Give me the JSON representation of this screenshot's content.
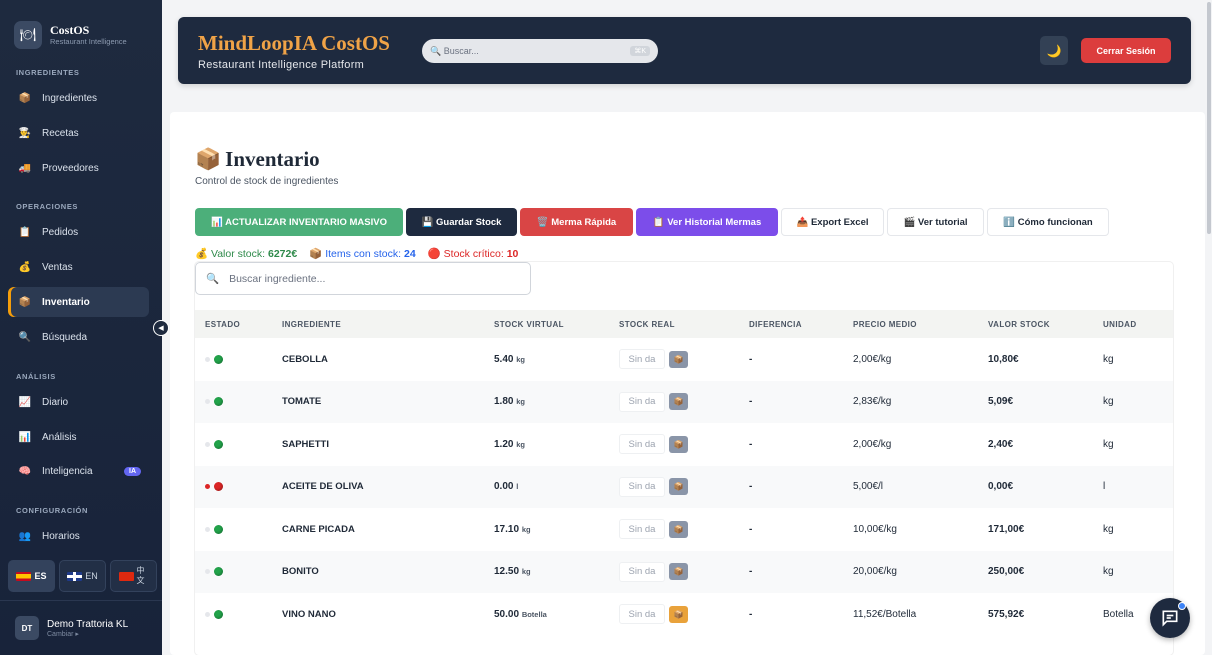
{
  "sidebar": {
    "brand_name": "CostOS",
    "brand_sub": "Restaurant Intelligence",
    "sections": {
      "ingredientes": "INGREDIENTES",
      "operaciones": "OPERACIONES",
      "analisis": "ANÁLISIS",
      "configuracion": "CONFIGURACIÓN"
    },
    "items": {
      "ingredientes": "Ingredientes",
      "recetas": "Recetas",
      "proveedores": "Proveedores",
      "pedidos": "Pedidos",
      "ventas": "Ventas",
      "inventario": "Inventario",
      "busqueda": "Búsqueda",
      "diario": "Diario",
      "analisis": "Análisis",
      "inteligencia": "Inteligencia",
      "horarios": "Horarios"
    },
    "ia_badge": "IA",
    "languages": {
      "es": "ES",
      "en": "EN",
      "zh": "中文"
    },
    "user": {
      "initials": "DT",
      "name": "Demo Trattoria KL",
      "sub": "Cambiar ▸"
    }
  },
  "header": {
    "title": "MindLoopIA CostOS",
    "subtitle": "Restaurant Intelligence Platform",
    "search_placeholder": "🔍 Buscar...",
    "search_kbd": "⌘K",
    "theme_icon": "🌙",
    "logout": "Cerrar Sesión"
  },
  "page": {
    "title_icon": "📦",
    "title": "Inventario",
    "subtitle": "Control de stock de ingredientes"
  },
  "toolbar": {
    "massive": "📊 ACTUALIZAR INVENTARIO MASIVO",
    "save": "💾 Guardar Stock",
    "merma": "🗑️ Merma Rápida",
    "historial": "📋 Ver Historial Mermas",
    "export": "📤 Export Excel",
    "tutorial": "🎬 Ver tutorial",
    "howto": "ℹ️ Cómo funcionan"
  },
  "stats": {
    "value_label": "💰 Valor stock:",
    "value": "6272€",
    "items_label": "📦 Items con stock:",
    "items": "24",
    "critical_label": "🔴 Stock crítico:",
    "critical": "10"
  },
  "table": {
    "search_placeholder": "Buscar ingrediente...",
    "columns": [
      "ESTADO",
      "INGREDIENTE",
      "STOCK VIRTUAL",
      "STOCK REAL",
      "DIFERENCIA",
      "PRECIO MEDIO",
      "VALOR STOCK",
      "UNIDAD"
    ],
    "input_placeholder": "Sin da",
    "rows": [
      {
        "status": "ok",
        "name": "CEBOLLA",
        "virtual": "5.40",
        "virtual_unit": "kg",
        "diff": "-",
        "price": "2,00€/kg",
        "value": "10,80€",
        "unit": "kg",
        "btn": "gray"
      },
      {
        "status": "ok",
        "name": "TOMATE",
        "virtual": "1.80",
        "virtual_unit": "kg",
        "diff": "-",
        "price": "2,83€/kg",
        "value": "5,09€",
        "unit": "kg",
        "btn": "gray"
      },
      {
        "status": "ok",
        "name": "SAPHETTI",
        "virtual": "1.20",
        "virtual_unit": "kg",
        "diff": "-",
        "price": "2,00€/kg",
        "value": "2,40€",
        "unit": "kg",
        "btn": "gray"
      },
      {
        "status": "critical",
        "name": "ACEITE DE OLIVA",
        "virtual": "0.00",
        "virtual_unit": "l",
        "diff": "-",
        "price": "5,00€/l",
        "value": "0,00€",
        "unit": "l",
        "btn": "gray"
      },
      {
        "status": "ok",
        "name": "CARNE PICADA",
        "virtual": "17.10",
        "virtual_unit": "kg",
        "diff": "-",
        "price": "10,00€/kg",
        "value": "171,00€",
        "unit": "kg",
        "btn": "gray"
      },
      {
        "status": "ok",
        "name": "BONITO",
        "virtual": "12.50",
        "virtual_unit": "kg",
        "diff": "-",
        "price": "20,00€/kg",
        "value": "250,00€",
        "unit": "kg",
        "btn": "gray"
      },
      {
        "status": "ok",
        "name": "VINO NANO",
        "virtual": "50.00",
        "virtual_unit": "Botella",
        "diff": "-",
        "price": "11,52€/Botella",
        "value": "575,92€",
        "unit": "Botella",
        "btn": "orange"
      }
    ]
  },
  "icons": {
    "collapse": "◀",
    "search": "🔍",
    "box": "📦"
  }
}
